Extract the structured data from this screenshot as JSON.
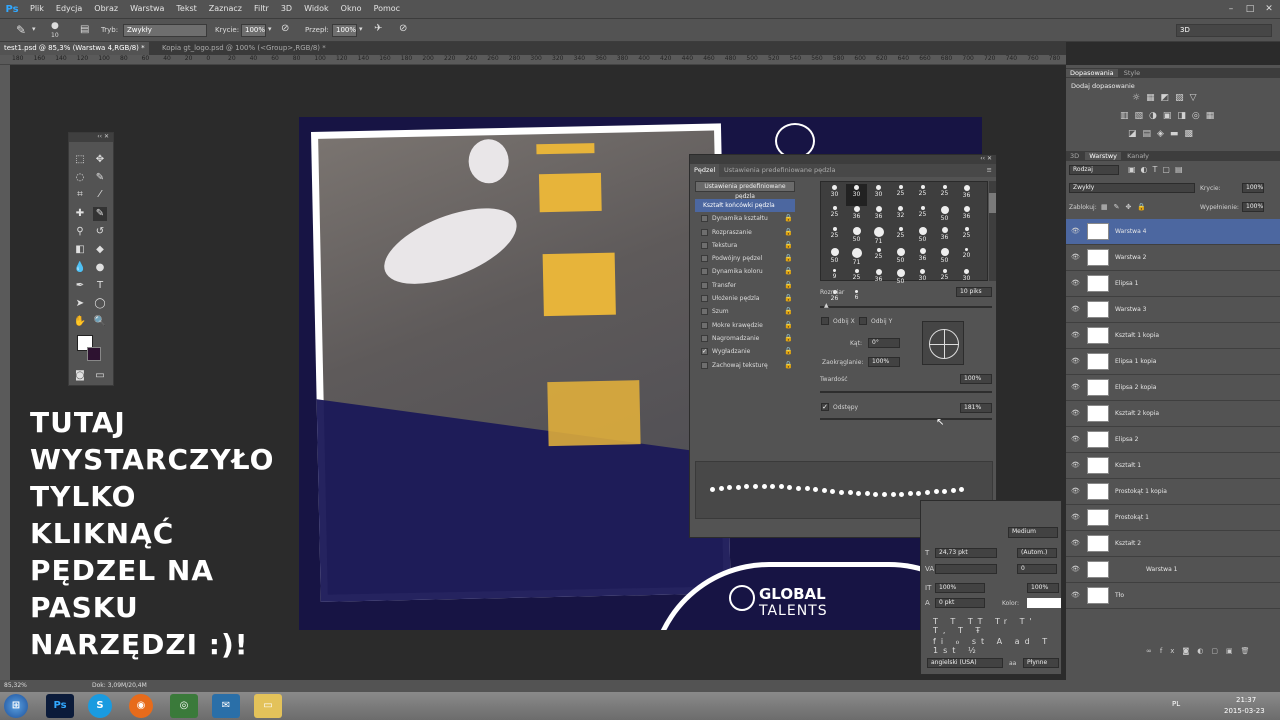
{
  "app": {
    "logo": "Ps"
  },
  "menu": [
    "Plik",
    "Edycja",
    "Obraz",
    "Warstwa",
    "Tekst",
    "Zaznacz",
    "Filtr",
    "3D",
    "Widok",
    "Okno",
    "Pomoc"
  ],
  "options": {
    "brush_size": "10",
    "mode_label": "Tryb:",
    "mode_value": "Zwykły",
    "opacity_label": "Krycie:",
    "opacity_value": "100%",
    "flow_label": "Przepł:",
    "flow_value": "100%",
    "workspace": "3D"
  },
  "tabs": [
    {
      "label": "test1.psd @ 85,3% (Warstwa 4,RGB/8) *"
    },
    {
      "label": "Kopia gt_logo.psd @ 100% (<Group>,RGB/8) *"
    }
  ],
  "ruler": [
    "180",
    "160",
    "140",
    "120",
    "100",
    "80",
    "60",
    "40",
    "20",
    "0",
    "20",
    "40",
    "60",
    "80",
    "100",
    "120",
    "140",
    "160",
    "180",
    "200",
    "220",
    "240",
    "260",
    "280",
    "300",
    "320",
    "340",
    "360",
    "380",
    "400",
    "420",
    "440",
    "460",
    "480",
    "500",
    "520",
    "540",
    "560",
    "580",
    "600",
    "620",
    "640",
    "660",
    "680",
    "700",
    "720",
    "740",
    "760",
    "780"
  ],
  "overlay_text": [
    "TUTAJ",
    "WYSTARCZYŁO",
    "TYLKO",
    "KLIKNĄĆ",
    "PĘDZEL NA",
    "PASKU",
    "NARZĘDZI :)!"
  ],
  "artwork": {
    "logo_line1": "GLOBAL",
    "logo_line2": "TALENTS"
  },
  "brush_panel": {
    "tab_active": "Pędzel",
    "tab_other": "Ustawienia predefiniowane pędzla",
    "preset_button": "Ustawienia predefiniowane pędzla",
    "options": [
      {
        "label": "Kształt końcówki pędzla",
        "selected": true,
        "checkbox": false
      },
      {
        "label": "Dynamika kształtu",
        "checked": false
      },
      {
        "label": "Rozpraszanie",
        "checked": false
      },
      {
        "label": "Tekstura",
        "checked": false
      },
      {
        "label": "Podwójny pędzel",
        "checked": false
      },
      {
        "label": "Dynamika koloru",
        "checked": false
      },
      {
        "label": "Transfer",
        "checked": false
      },
      {
        "label": "Ułożenie pędzla",
        "checked": false
      },
      {
        "label": "Szum",
        "checked": false
      },
      {
        "label": "Mokre krawędzie",
        "checked": false
      },
      {
        "label": "Nagromadzanie",
        "checked": false
      },
      {
        "label": "Wygładzanie",
        "checked": true
      },
      {
        "label": "Zachowaj teksturę",
        "checked": false
      }
    ],
    "tip_sizes": [
      "30",
      "30",
      "30",
      "25",
      "25",
      "25",
      "36",
      "25",
      "36",
      "36",
      "32",
      "25",
      "50",
      "36",
      "25",
      "50",
      "71",
      "25",
      "50",
      "36",
      "25",
      "50",
      "71",
      "25",
      "50",
      "36",
      "50",
      "20",
      "9",
      "25",
      "36",
      "50",
      "30",
      "25",
      "30",
      "26",
      "6"
    ],
    "size_label": "Rozmiar",
    "size_value": "10 piks",
    "flip_x": "Odbij X",
    "flip_y": "Odbij Y",
    "angle_label": "Kąt:",
    "angle_value": "0°",
    "roundness_label": "Zaokrąglanie:",
    "roundness_value": "100%",
    "hardness_label": "Twardość",
    "hardness_value": "100%",
    "spacing_label": "Odstępy",
    "spacing_value": "181%"
  },
  "character_panel": {
    "style": "Medium",
    "leading": "24,73 pkt",
    "leading2": "(Autom.)",
    "tracking": "0",
    "vscale": "100%",
    "hscale": "100%",
    "baseline": "0 pkt",
    "color_label": "Kolor:",
    "lang": "angielski (USA)",
    "aa": "Płynne"
  },
  "right_panel": {
    "tab1": "Dopasowania",
    "tab2": "Style",
    "add_adjust": "Dodaj dopasowanie",
    "layer_tabs": [
      "3D",
      "Warstwy",
      "Kanały"
    ],
    "kind": "Rodzaj",
    "blend": "Zwykły",
    "opacity_label": "Krycie:",
    "opacity_value": "100%",
    "lock_label": "Zablokuj:",
    "fill_label": "Wypełnienie:",
    "fill_value": "100%",
    "layers": [
      {
        "name": "Warstwa 4",
        "selected": true
      },
      {
        "name": "Warstwa 2"
      },
      {
        "name": "Elipsa 1"
      },
      {
        "name": "Warstwa 3"
      },
      {
        "name": "Kształt 1 kopia"
      },
      {
        "name": "Elipsa 1 kopia"
      },
      {
        "name": "Elipsa 2 kopia"
      },
      {
        "name": "Kształt 2 kopia"
      },
      {
        "name": "Elipsa 2"
      },
      {
        "name": "Kształt 1"
      },
      {
        "name": "Prostokąt 1 kopia"
      },
      {
        "name": "Prostokąt 1"
      },
      {
        "name": "Kształt 2"
      },
      {
        "name": "Warstwa 1"
      },
      {
        "name": "Tło"
      }
    ]
  },
  "status": {
    "zoom": "85,32%",
    "doc": "Dok: 3,09M/20,4M"
  },
  "taskbar": {
    "lang": "PL",
    "time": "21:37",
    "date": "2015-03-23"
  }
}
